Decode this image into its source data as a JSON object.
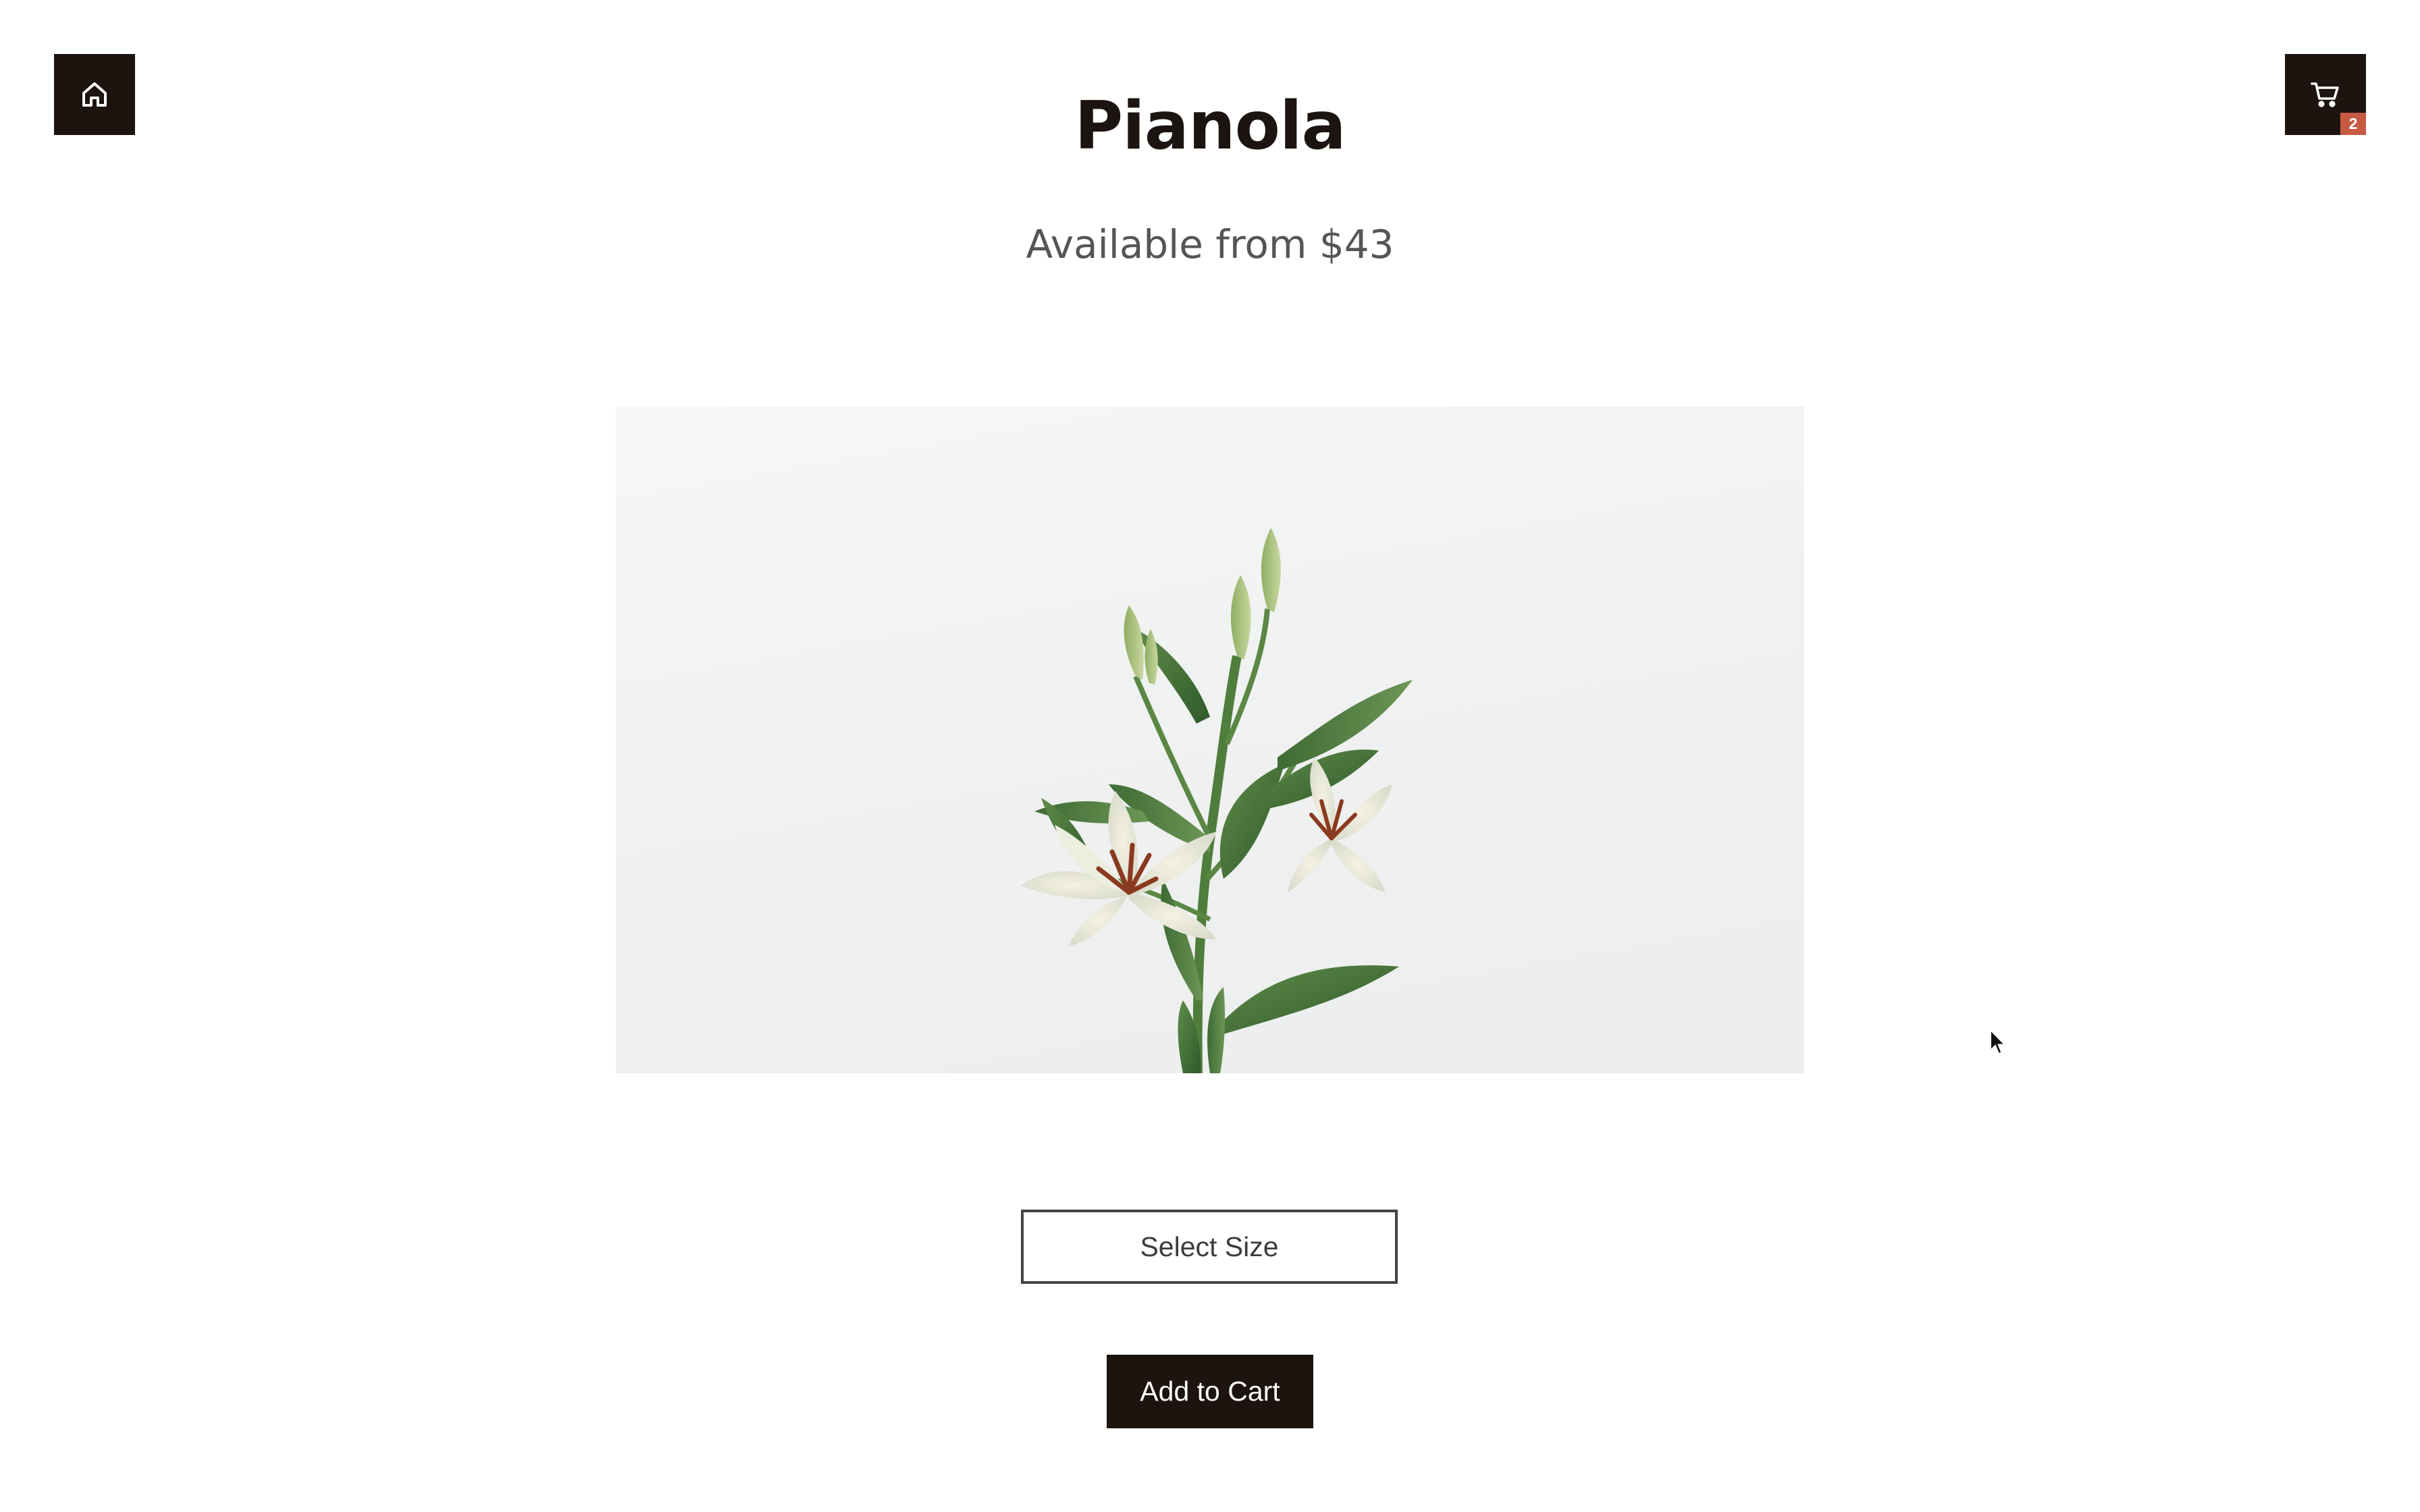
{
  "header": {
    "home_icon": "home-icon",
    "cart_icon": "cart-icon",
    "cart_count": "2"
  },
  "product": {
    "title": "Pianola",
    "price_text": "Available from $43",
    "image_subject": "white lily bouquet"
  },
  "controls": {
    "select_size_label": "Select Size",
    "add_to_cart_label": "Add to Cart"
  },
  "colors": {
    "primary_dark": "#1d1410",
    "badge": "#c65a43",
    "subtitle": "#555555",
    "image_background": "#eff1f1"
  }
}
